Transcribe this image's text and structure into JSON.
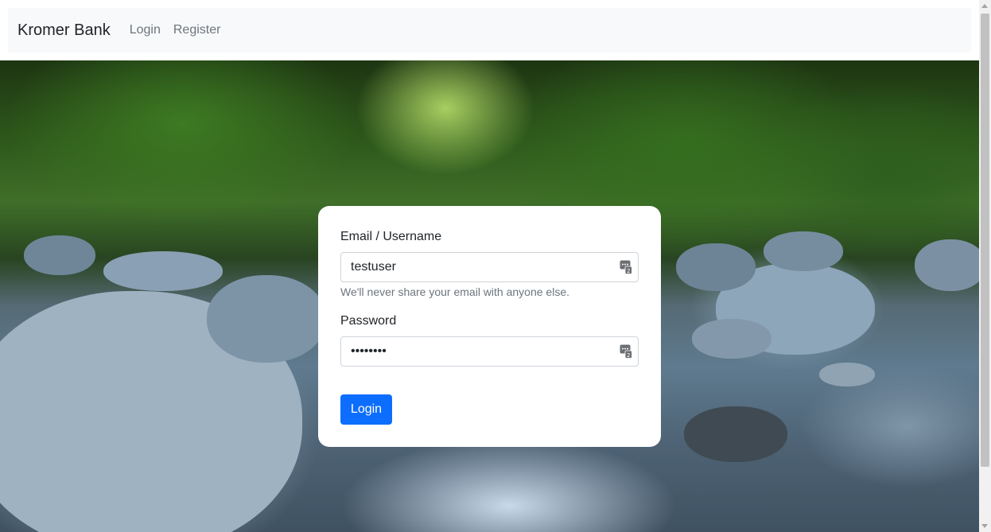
{
  "navbar": {
    "brand": "Kromer Bank",
    "links": [
      {
        "label": "Login"
      },
      {
        "label": "Register"
      }
    ]
  },
  "form": {
    "email_label": "Email / Username",
    "email_value": "testuser",
    "email_help": "We'll never share your email with anyone else.",
    "password_label": "Password",
    "password_value": "testuser",
    "submit_label": "Login",
    "field_icon": "password-manager-key-icon"
  },
  "theme": {
    "primary": "#0d6efd",
    "navbar_bg": "#f8f9fa"
  }
}
